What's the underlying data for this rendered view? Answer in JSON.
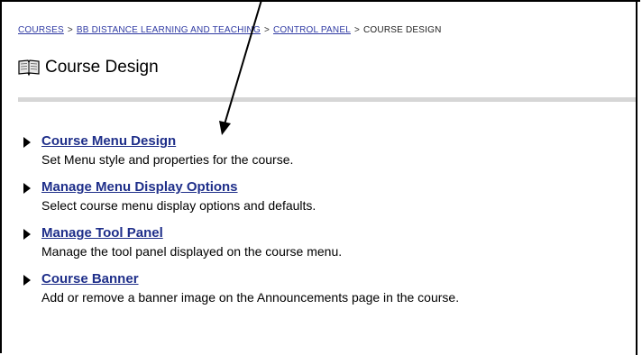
{
  "breadcrumb": {
    "items": [
      {
        "label": "COURSES",
        "link": true
      },
      {
        "label": "BB DISTANCE LEARNING AND TEACHING",
        "link": true
      },
      {
        "label": "CONTROL PANEL",
        "link": true
      },
      {
        "label": "COURSE DESIGN",
        "link": false
      }
    ],
    "separator": ">"
  },
  "page": {
    "title": "Course Design",
    "icon": "book-icon"
  },
  "tools": [
    {
      "label": "Course Menu Design",
      "description": "Set Menu style and properties for the course."
    },
    {
      "label": "Manage Menu Display Options",
      "description": "Select course menu display options and defaults."
    },
    {
      "label": "Manage Tool Panel",
      "description": "Manage the tool panel displayed on the course menu."
    },
    {
      "label": "Course Banner",
      "description": "Add or remove a banner image on the Announcements page in the course."
    }
  ],
  "colors": {
    "link": "#1f2f8a",
    "breadcrumb_link": "#2f3aa3",
    "divider": "#d6d6d6"
  }
}
